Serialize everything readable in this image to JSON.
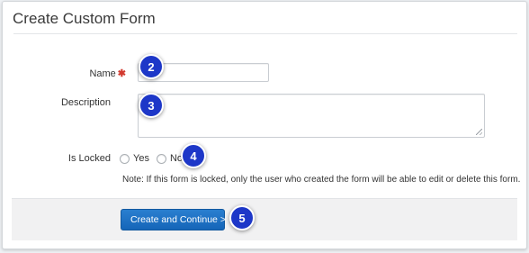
{
  "form": {
    "title": "Create Custom Form",
    "name_label": "Name",
    "required_mark": "✱",
    "name_value": "",
    "description_label": "Description",
    "description_value": "",
    "locked_label": "Is Locked",
    "option_yes": "Yes",
    "option_no": "No",
    "selected_option": "",
    "note": "Note: If this form is locked, only the user who created the form will be able to edit or delete this form.",
    "submit_label": "Create and Continue >"
  },
  "step_markers": [
    "2",
    "3",
    "4",
    "5"
  ],
  "colors": {
    "accent": "#1565b8",
    "marker": "#1d37c8",
    "required": "#d23a2f"
  },
  "icons": [
    "required-asterisk-icon",
    "textarea-resize-icon"
  ]
}
